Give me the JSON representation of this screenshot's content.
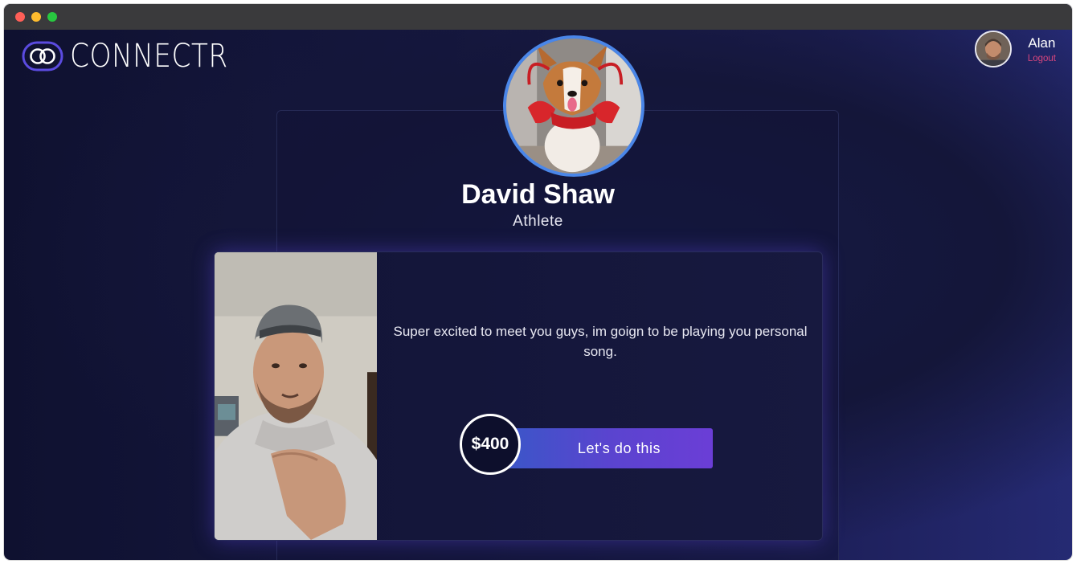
{
  "app": {
    "name": "CONNECTR"
  },
  "user": {
    "name": "Alan",
    "logout_label": "Logout"
  },
  "profile": {
    "name": "David Shaw",
    "role": "Athlete"
  },
  "offer": {
    "message": "Super excited to meet you guys, im goign to be playing you personal song.",
    "price": "$400",
    "cta_label": "Let's do this"
  },
  "colors": {
    "accent": "#4a86e8",
    "logout": "#d8467d",
    "button_start": "#3b56c8",
    "button_end": "#6b3ed6",
    "logo_icon": "#5b4be0"
  },
  "icons": {
    "logo": "interlocking-rings-icon"
  }
}
